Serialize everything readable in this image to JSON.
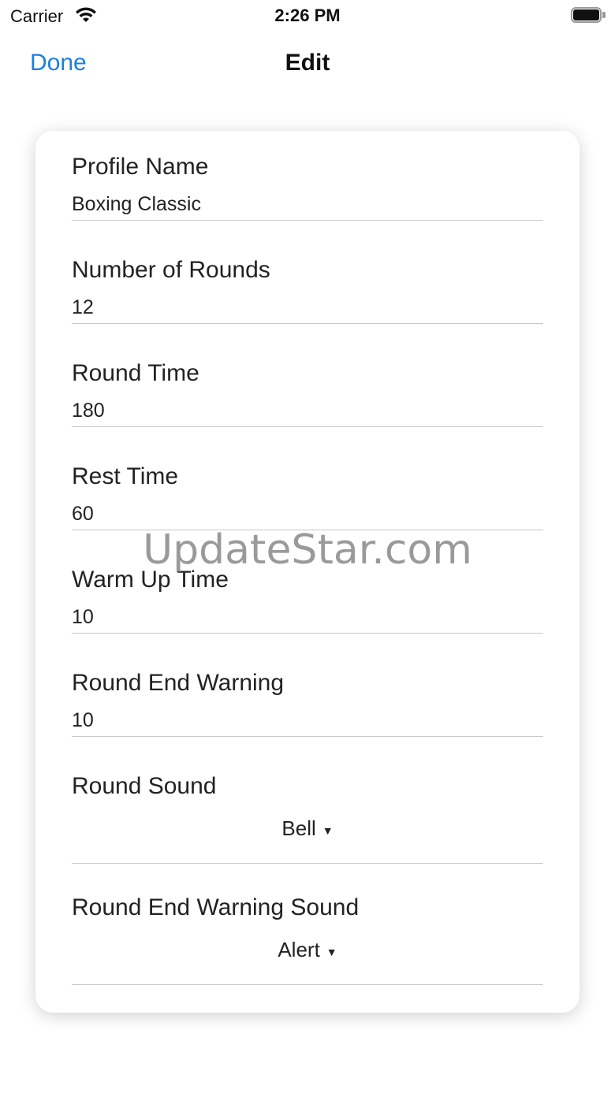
{
  "status_bar": {
    "carrier": "Carrier",
    "time": "2:26 PM"
  },
  "nav": {
    "done_label": "Done",
    "title": "Edit"
  },
  "form": {
    "fields": [
      {
        "label": "Profile Name",
        "value": "Boxing Classic"
      },
      {
        "label": "Number of Rounds",
        "value": "12"
      },
      {
        "label": "Round Time",
        "value": "180"
      },
      {
        "label": "Rest Time",
        "value": "60"
      },
      {
        "label": "Warm Up Time",
        "value": "10"
      },
      {
        "label": "Round End Warning",
        "value": "10"
      }
    ],
    "selects": [
      {
        "label": "Round Sound",
        "value": "Bell"
      },
      {
        "label": "Round End Warning Sound",
        "value": "Alert"
      }
    ]
  },
  "watermark": "UpdateStar.com",
  "colors": {
    "accent": "#1a7fe0",
    "divider": "#c8c8c8"
  }
}
